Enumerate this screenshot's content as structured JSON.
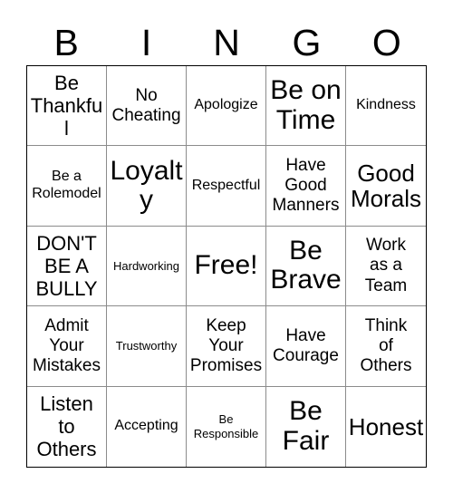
{
  "card": {
    "title": "BINGO",
    "header_letters": [
      "B",
      "I",
      "N",
      "G",
      "O"
    ],
    "colors": {
      "background": "#ffffff",
      "text": "#000000",
      "outer_border": "#000000",
      "inner_border": "#8c8c8c"
    },
    "grid": {
      "rows": 5,
      "columns": 5
    },
    "cells": [
      {
        "text": "Be\nThankful",
        "size": "fs-md"
      },
      {
        "text": "No\nCheating",
        "size": "fs-sm"
      },
      {
        "text": "Apologize",
        "size": "fs-xs"
      },
      {
        "text": "Be on\nTime",
        "size": "fs-xl"
      },
      {
        "text": "Kindness",
        "size": "fs-xs"
      },
      {
        "text": "Be a\nRolemodel",
        "size": "fs-xs"
      },
      {
        "text": "Loyalty",
        "size": "fs-xl"
      },
      {
        "text": "Respectful",
        "size": "fs-xs"
      },
      {
        "text": "Have\nGood\nManners",
        "size": "fs-sm"
      },
      {
        "text": "Good\nMorals",
        "size": "fs-lg"
      },
      {
        "text": "DON'T\nBE A\nBULLY",
        "size": "fs-md"
      },
      {
        "text": "Hardworking",
        "size": "fs-xxs"
      },
      {
        "text": "Free!",
        "size": "fs-xl"
      },
      {
        "text": "Be\nBrave",
        "size": "fs-xl"
      },
      {
        "text": "Work\nas a\nTeam",
        "size": "fs-sm"
      },
      {
        "text": "Admit\nYour\nMistakes",
        "size": "fs-sm"
      },
      {
        "text": "Trustworthy",
        "size": "fs-xxs"
      },
      {
        "text": "Keep\nYour\nPromises",
        "size": "fs-sm"
      },
      {
        "text": "Have\nCourage",
        "size": "fs-sm"
      },
      {
        "text": "Think\nof\nOthers",
        "size": "fs-sm"
      },
      {
        "text": "Listen\nto\nOthers",
        "size": "fs-md"
      },
      {
        "text": "Accepting",
        "size": "fs-xs"
      },
      {
        "text": "Be\nResponsible",
        "size": "fs-xxs"
      },
      {
        "text": "Be\nFair",
        "size": "fs-xl"
      },
      {
        "text": "Honest",
        "size": "fs-lg"
      }
    ]
  }
}
